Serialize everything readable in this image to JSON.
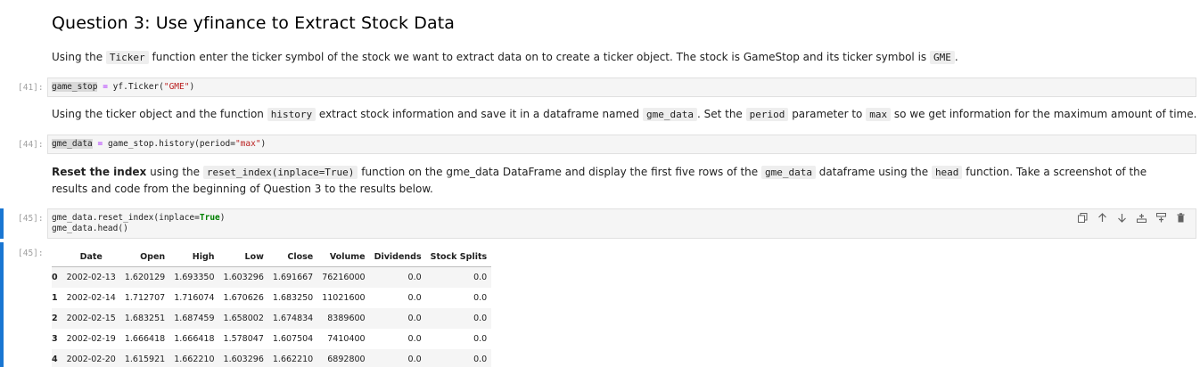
{
  "heading": "Question 3: Use yfinance to Extract Stock Data",
  "md1": {
    "p1": "Using the ",
    "c1": "Ticker",
    "p2": " function enter the ticker symbol of the stock we want to extract data on to create a ticker object. The stock is GameStop and its ticker symbol is ",
    "c2": "GME",
    "p3": "."
  },
  "cell41": {
    "prompt": "[41]:",
    "var": "game_stop",
    "eq": " = ",
    "call": "yf.Ticker(",
    "arg": "\"GME\"",
    "close": ")"
  },
  "md2": {
    "p1": "Using the ticker object and the function ",
    "c1": "history",
    "p2": " extract stock information and save it in a dataframe named ",
    "c2": "gme_data",
    "p3": ". Set the ",
    "c3": "period",
    "p4": " parameter to ",
    "c4": "max",
    "p5": " so we get information for the maximum amount of time."
  },
  "cell44": {
    "prompt": "[44]:",
    "var": "gme_data",
    "eq": " = ",
    "call": "game_stop.history(period=",
    "arg": "\"max\"",
    "close": ")"
  },
  "md3": {
    "bold": "Reset the index",
    "p1": " using the ",
    "c1": "reset_index(inplace=True)",
    "p2": " function on the gme_data DataFrame and display the first five rows of the ",
    "c2": "gme_data",
    "p3": " dataframe using the ",
    "c3": "head",
    "p4": " function. Take a screenshot of the results and code from the beginning of Question 3 to the results below."
  },
  "cell45": {
    "prompt": "[45]:",
    "l1a": "gme_data.reset_index(inplace=",
    "l1b": "True",
    "l1c": ")",
    "l2": "gme_data.head()",
    "out_prompt": "[45]:"
  },
  "toolbar": {
    "icons": [
      "copy-icon",
      "arrow-up-icon",
      "arrow-down-icon",
      "insert-above-icon",
      "insert-below-icon",
      "delete-icon"
    ]
  },
  "table": {
    "columns": [
      "",
      "Date",
      "Open",
      "High",
      "Low",
      "Close",
      "Volume",
      "Dividends",
      "Stock Splits"
    ],
    "rows": [
      [
        "0",
        "2002-02-13",
        "1.620129",
        "1.693350",
        "1.603296",
        "1.691667",
        "76216000",
        "0.0",
        "0.0"
      ],
      [
        "1",
        "2002-02-14",
        "1.712707",
        "1.716074",
        "1.670626",
        "1.683250",
        "11021600",
        "0.0",
        "0.0"
      ],
      [
        "2",
        "2002-02-15",
        "1.683251",
        "1.687459",
        "1.658002",
        "1.674834",
        "8389600",
        "0.0",
        "0.0"
      ],
      [
        "3",
        "2002-02-19",
        "1.666418",
        "1.666418",
        "1.578047",
        "1.607504",
        "7410400",
        "0.0",
        "0.0"
      ],
      [
        "4",
        "2002-02-20",
        "1.615921",
        "1.662210",
        "1.603296",
        "1.662210",
        "6892800",
        "0.0",
        "0.0"
      ]
    ]
  }
}
